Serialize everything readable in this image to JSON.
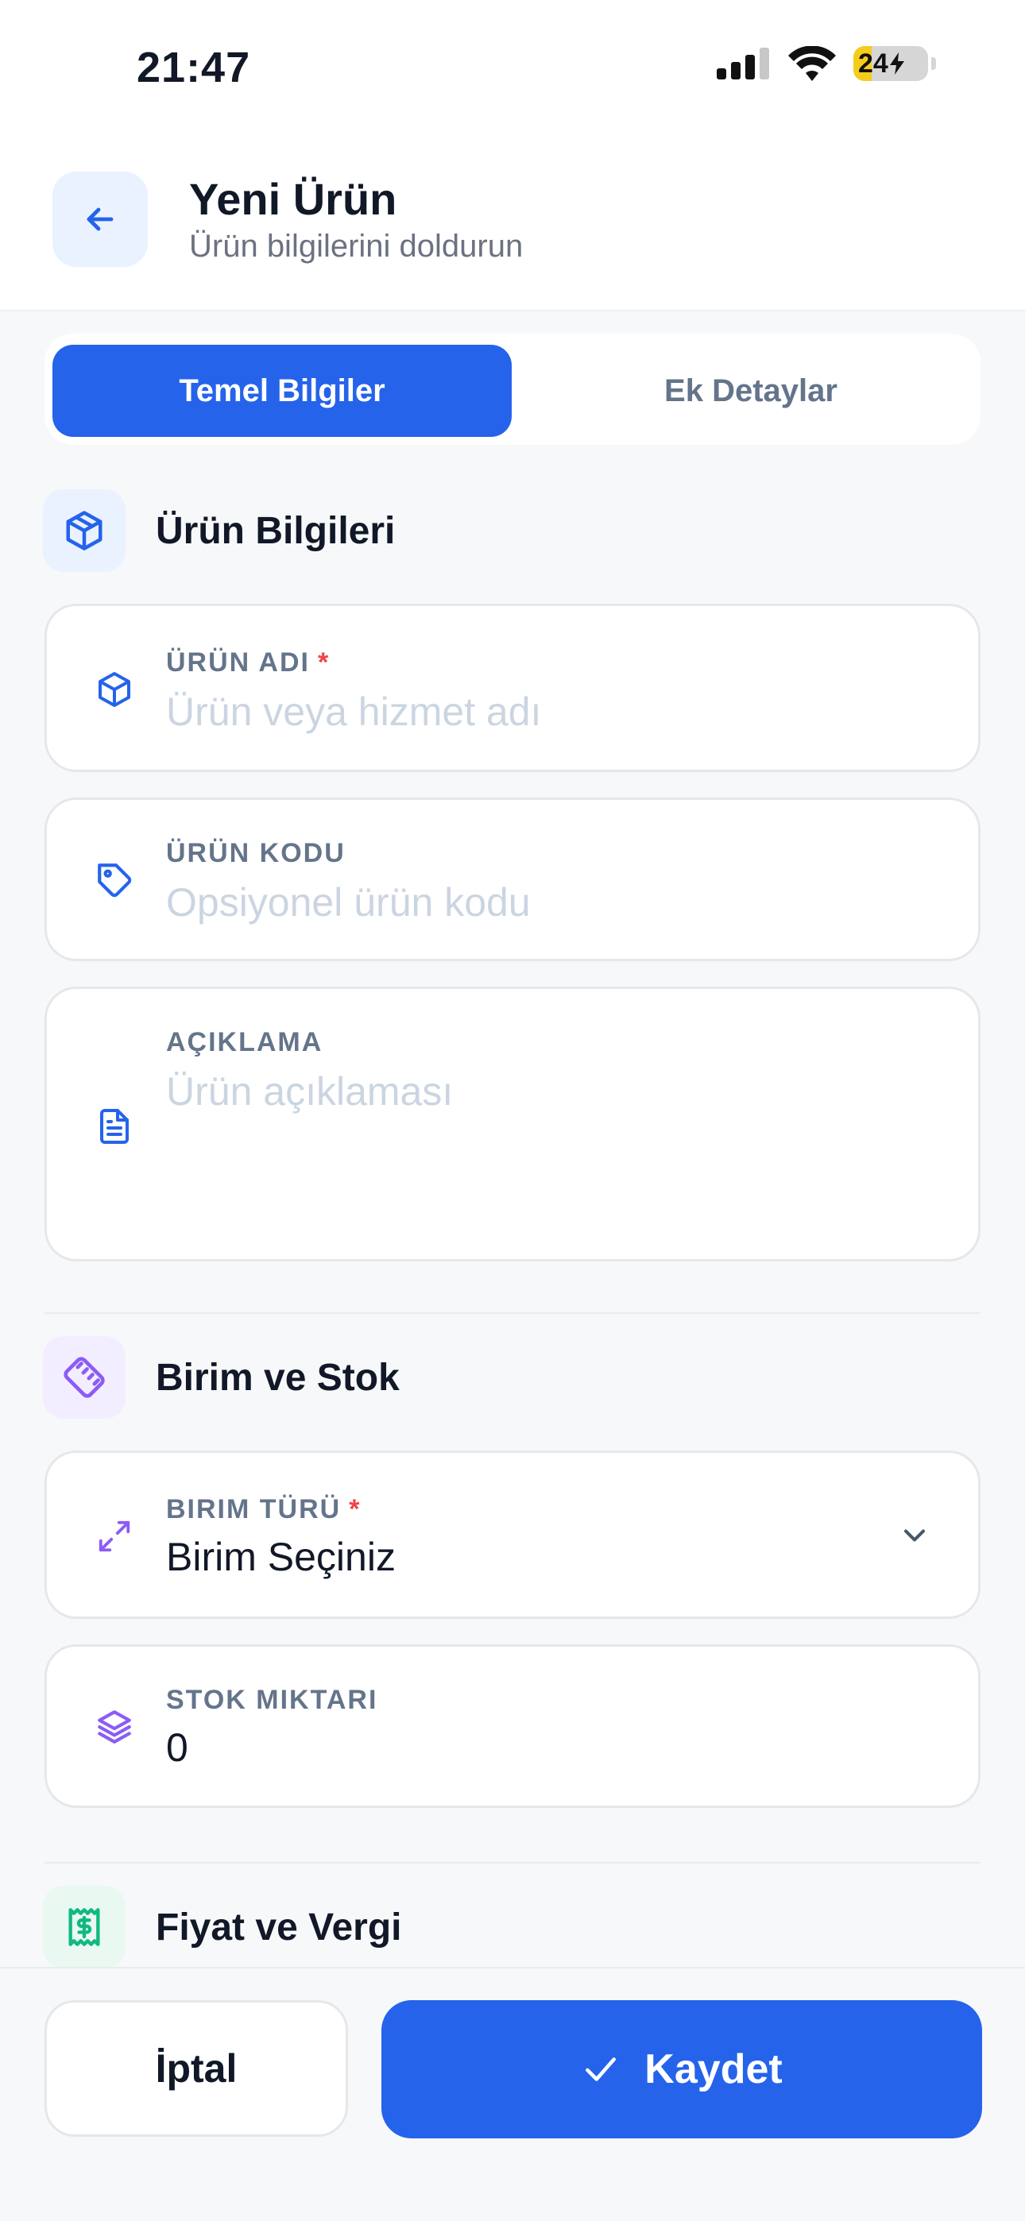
{
  "status_bar": {
    "time": "21:47",
    "battery": "24",
    "battery_level": 0.24
  },
  "header": {
    "title": "Yeni Ürün",
    "subtitle": "Ürün bilgilerini doldurun"
  },
  "tabs": [
    {
      "label": "Temel Bilgiler",
      "active": true
    },
    {
      "label": "Ek Detaylar",
      "active": false
    }
  ],
  "sections": {
    "product": {
      "title": "Ürün Bilgileri",
      "fields": {
        "name": {
          "label": "ÜRÜN ADI",
          "required": "*",
          "placeholder": "Ürün veya hizmet adı"
        },
        "code": {
          "label": "ÜRÜN KODU",
          "placeholder": "Opsiyonel ürün kodu"
        },
        "description": {
          "label": "AÇIKLAMA",
          "placeholder": "Ürün açıklaması"
        }
      }
    },
    "unit_stock": {
      "title": "Birim ve Stok",
      "fields": {
        "unit_type": {
          "label": "BIRIM TÜRÜ",
          "required": "*",
          "value": "Birim Seçiniz"
        },
        "stock": {
          "label": "STOK MIKTARI",
          "value": "0"
        }
      }
    },
    "price_tax": {
      "title": "Fiyat ve Vergi"
    }
  },
  "actions": {
    "cancel": "İptal",
    "save": "Kaydet"
  },
  "colors": {
    "primary": "#2563EB",
    "purple_accent": "#8B5CF6",
    "green_accent": "#10B981",
    "required": "#EF4444"
  },
  "icons": {
    "back": "arrow-left-icon",
    "product_section": "package-icon",
    "name": "cube-icon",
    "code": "tag-icon",
    "description": "document-icon",
    "unit_section": "ruler-icon",
    "unit_type": "arrows-diagonal-icon",
    "stock": "layers-icon",
    "price_section": "receipt-icon",
    "save": "check-icon"
  }
}
